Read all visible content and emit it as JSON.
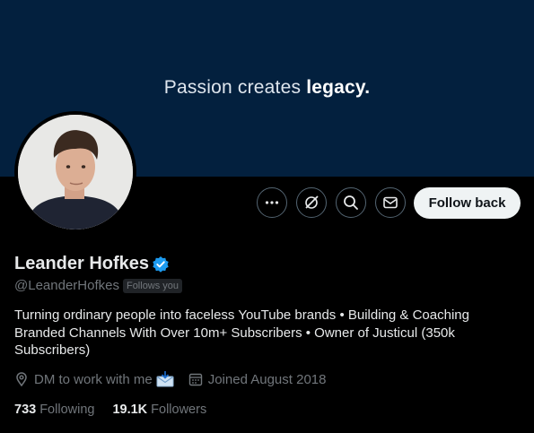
{
  "banner": {
    "text_regular": "Passion creates ",
    "text_bold": "legacy."
  },
  "colors": {
    "banner_bg": "#03203e",
    "verified_blue": "#1d9bf0",
    "muted": "#71767b",
    "text": "#e7e9ea"
  },
  "actions": {
    "more_icon": "more-icon",
    "grok_icon": "grok-icon",
    "search_icon": "search-icon",
    "message_icon": "envelope-icon",
    "follow_back_label": "Follow back"
  },
  "profile": {
    "name": "Leander Hofkes",
    "handle": "@LeanderHofkes",
    "follows_you": "Follows you",
    "bio": "Turning ordinary people into faceless YouTube brands • Building & Coaching Branded Channels With Over 10m+ Subscribers • Owner of Justicul (350k Subscribers)",
    "location": "DM to work with me",
    "joined": "Joined August 2018"
  },
  "stats": {
    "following_count": "733",
    "following_label": "Following",
    "followers_count": "19.1K",
    "followers_label": "Followers"
  }
}
